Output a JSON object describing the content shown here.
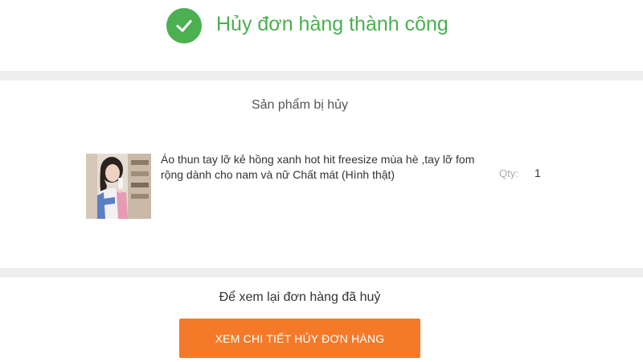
{
  "banner": {
    "title": "Hủy đơn hàng thành công",
    "icon": "checkmark-icon",
    "color": "#4caf50"
  },
  "cancelled_products": {
    "heading": "Sản phẩm bị hủy",
    "items": [
      {
        "name": "Áo thun tay lỡ kẻ hồng xanh hot hit freesize mùa hè ,tay lỡ fom rộng dành cho nam và nữ Chất mát (Hình thật)",
        "qty_label": "Qty:",
        "qty": "1"
      }
    ]
  },
  "footer": {
    "text": "Để xem lại đơn hàng đã huỷ",
    "button_label": "XEM CHI TIẾT HỦY ĐƠN HÀNG",
    "button_color": "#f47a2a"
  }
}
